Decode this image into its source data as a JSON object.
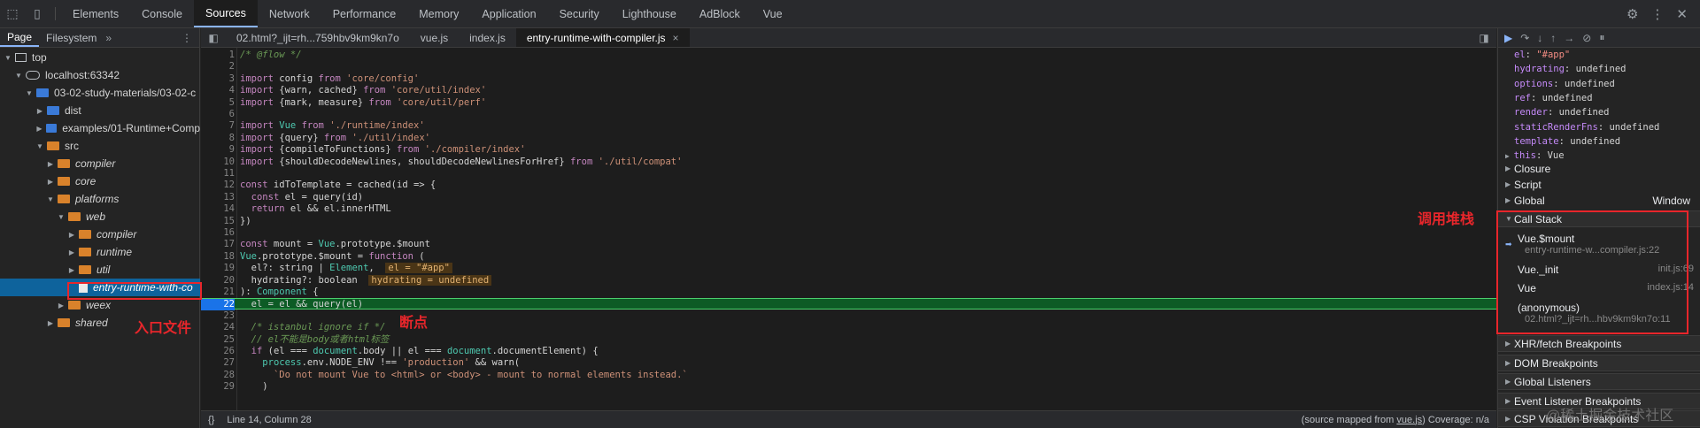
{
  "top_tabs": [
    "Elements",
    "Console",
    "Sources",
    "Network",
    "Performance",
    "Memory",
    "Application",
    "Security",
    "Lighthouse",
    "AdBlock",
    "Vue"
  ],
  "navigator": {
    "tabs": [
      "Page",
      "Filesystem"
    ],
    "more": "»",
    "tree": [
      {
        "label": "top",
        "depth": 0,
        "icon": "frame"
      },
      {
        "label": "localhost:63342",
        "depth": 1,
        "icon": "cloud"
      },
      {
        "label": "03-02-study-materials/03-02-c",
        "depth": 2,
        "icon": "folder-blue"
      },
      {
        "label": "dist",
        "depth": 3,
        "icon": "folder-blue"
      },
      {
        "label": "examples/01-Runtime+Comp",
        "depth": 3,
        "icon": "folder-blue"
      },
      {
        "label": "src",
        "depth": 3,
        "icon": "folder-orange"
      },
      {
        "label": "compiler",
        "depth": 4,
        "icon": "folder-orange"
      },
      {
        "label": "core",
        "depth": 4,
        "icon": "folder-orange"
      },
      {
        "label": "platforms",
        "depth": 4,
        "icon": "folder-orange"
      },
      {
        "label": "web",
        "depth": 5,
        "icon": "folder-orange"
      },
      {
        "label": "compiler",
        "depth": 6,
        "icon": "folder-orange"
      },
      {
        "label": "runtime",
        "depth": 6,
        "icon": "folder-orange"
      },
      {
        "label": "util",
        "depth": 6,
        "icon": "folder-orange"
      },
      {
        "label": "entry-runtime-with-co",
        "depth": 6,
        "icon": "file"
      },
      {
        "label": "weex",
        "depth": 5,
        "icon": "folder-orange"
      },
      {
        "label": "shared",
        "depth": 4,
        "icon": "folder-orange"
      }
    ]
  },
  "editor": {
    "tabs": [
      "02.html?_ijt=rh...759hbv9km9kn7o",
      "vue.js",
      "index.js",
      "entry-runtime-with-compiler.js"
    ],
    "close": "×",
    "status": {
      "braces": "{}",
      "position": "Line 14, Column 28",
      "source_mapped_prefix": "(source mapped from ",
      "source_mapped_link": "vue.js",
      "source_mapped_suffix": ")",
      "coverage": "Coverage: n/a"
    }
  },
  "code_lines": [
    {
      "n": "1",
      "code": "/* @flow */"
    },
    {
      "n": "2",
      "code": ""
    },
    {
      "n": "3",
      "code": "import config from 'core/config'"
    },
    {
      "n": "4",
      "code": "import {warn, cached} from 'core/util/index'"
    },
    {
      "n": "5",
      "code": "import {mark, measure} from 'core/util/perf'"
    },
    {
      "n": "6",
      "code": ""
    },
    {
      "n": "7",
      "code": "import Vue from './runtime/index'"
    },
    {
      "n": "8",
      "code": "import {query} from './util/index'"
    },
    {
      "n": "9",
      "code": "import {compileToFunctions} from './compiler/index'"
    },
    {
      "n": "10",
      "code": "import {shouldDecodeNewlines, shouldDecodeNewlinesForHref} from './util/compat'"
    },
    {
      "n": "11",
      "code": ""
    },
    {
      "n": "12",
      "code": "const idToTemplate = cached(id => {"
    },
    {
      "n": "13",
      "code": "  const el = query(id)"
    },
    {
      "n": "14",
      "code": "  return el && el.innerHTML"
    },
    {
      "n": "15",
      "code": "})"
    },
    {
      "n": "16",
      "code": ""
    },
    {
      "n": "17",
      "code": "const mount = Vue.prototype.$mount"
    },
    {
      "n": "18",
      "code": "Vue.prototype.$mount = function ("
    },
    {
      "n": "19",
      "code": "  el?: string | Element,",
      "inline": "el = \"#app\""
    },
    {
      "n": "20",
      "code": "  hydrating?: boolean",
      "inline": "hydrating = undefined"
    },
    {
      "n": "21",
      "code": "): Component {"
    },
    {
      "n": "22",
      "code": "  el = el && query(el)",
      "breakpoint": true
    },
    {
      "n": "23",
      "code": ""
    },
    {
      "n": "24",
      "code": "  /* istanbul ignore if */"
    },
    {
      "n": "25",
      "code": "  // el不能是body或者html标签"
    },
    {
      "n": "26",
      "code": "  if (el === document.body || el === document.documentElement) {"
    },
    {
      "n": "27",
      "code": "    process.env.NODE_ENV !== 'production' && warn("
    },
    {
      "n": "28",
      "code": "      `Do not mount Vue to <html> or <body> - mount to normal elements instead.`"
    },
    {
      "n": "29",
      "code": "    )"
    }
  ],
  "scope": [
    {
      "key": "el",
      "value": "\"#app\"",
      "string": true
    },
    {
      "key": "hydrating",
      "value": "undefined"
    },
    {
      "key": "options",
      "value": "undefined"
    },
    {
      "key": "ref",
      "value": "undefined"
    },
    {
      "key": "render",
      "value": "undefined"
    },
    {
      "key": "staticRenderFns",
      "value": "undefined"
    },
    {
      "key": "template",
      "value": "undefined"
    },
    {
      "key": "this",
      "value": "Vue",
      "expand": true
    }
  ],
  "scope_sections": [
    {
      "label": "Closure",
      "right": ""
    },
    {
      "label": "Script",
      "right": ""
    },
    {
      "label": "Global",
      "right": "Window"
    }
  ],
  "call_stack": {
    "title": "Call Stack",
    "frames": [
      {
        "name": "Vue.$mount",
        "location": "",
        "sub": "entry-runtime-w...compiler.js:22",
        "current": true
      },
      {
        "name": "Vue._init",
        "location": "init.js:69",
        "sub": ""
      },
      {
        "name": "Vue",
        "location": "index.js:14",
        "sub": ""
      },
      {
        "name": "(anonymous)",
        "location": "",
        "sub": "02.html?_ijt=rh...hbv9km9kn7o:11"
      }
    ]
  },
  "breakpoint_sections": [
    "XHR/fetch Breakpoints",
    "DOM Breakpoints",
    "Global Listeners",
    "Event Listener Breakpoints",
    "CSP Violation Breakpoints"
  ],
  "annotations": {
    "entry_file": "入口文件",
    "breakpoint": "断点",
    "call_stack": "调用堆栈"
  },
  "watermark": "@稀土掘金技术社区",
  "colors": {
    "accent": "#8ab4f8",
    "annotation_red": "#e8262b",
    "breakpoint_green": "#0d5b25"
  }
}
